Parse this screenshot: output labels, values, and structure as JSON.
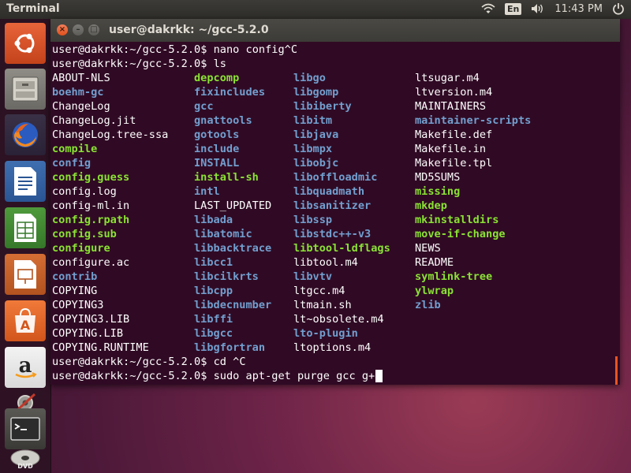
{
  "panel": {
    "app_title": "Terminal",
    "lang": "En",
    "time": "11:43 PM",
    "icons": [
      "wifi-icon",
      "keyboard-language",
      "volume-icon",
      "power-icon"
    ]
  },
  "launcher": {
    "items": [
      "ubuntu-dash",
      "files",
      "firefox",
      "libreoffice-writer",
      "libreoffice-calc",
      "libreoffice-impress",
      "ubuntu-software",
      "amazon",
      "system-settings",
      "terminal",
      "dvd"
    ]
  },
  "window": {
    "title": "user@dakrkk: ~/gcc-5.2.0"
  },
  "terminal": {
    "lines_before": [
      "user@dakrkk:~/gcc-5.2.0$ nano config^C",
      "user@dakrkk:~/gcc-5.2.0$ ls"
    ],
    "ls_columns": [
      [
        {
          "t": "ABOUT-NLS",
          "c": "file"
        },
        {
          "t": "boehm-gc",
          "c": "dir"
        },
        {
          "t": "ChangeLog",
          "c": "file"
        },
        {
          "t": "ChangeLog.jit",
          "c": "file"
        },
        {
          "t": "ChangeLog.tree-ssa",
          "c": "file"
        },
        {
          "t": "compile",
          "c": "exec"
        },
        {
          "t": "config",
          "c": "dir"
        },
        {
          "t": "config.guess",
          "c": "exec"
        },
        {
          "t": "config.log",
          "c": "file"
        },
        {
          "t": "config-ml.in",
          "c": "file"
        },
        {
          "t": "config.rpath",
          "c": "exec"
        },
        {
          "t": "config.sub",
          "c": "exec"
        },
        {
          "t": "configure",
          "c": "exec"
        },
        {
          "t": "configure.ac",
          "c": "file"
        },
        {
          "t": "contrib",
          "c": "dir"
        },
        {
          "t": "COPYING",
          "c": "file"
        },
        {
          "t": "COPYING3",
          "c": "file"
        },
        {
          "t": "COPYING3.LIB",
          "c": "file"
        },
        {
          "t": "COPYING.LIB",
          "c": "file"
        },
        {
          "t": "COPYING.RUNTIME",
          "c": "file"
        }
      ],
      [
        {
          "t": "depcomp",
          "c": "exec"
        },
        {
          "t": "fixincludes",
          "c": "dir"
        },
        {
          "t": "gcc",
          "c": "dir"
        },
        {
          "t": "gnattools",
          "c": "dir"
        },
        {
          "t": "gotools",
          "c": "dir"
        },
        {
          "t": "include",
          "c": "dir"
        },
        {
          "t": "INSTALL",
          "c": "dir"
        },
        {
          "t": "install-sh",
          "c": "exec"
        },
        {
          "t": "intl",
          "c": "dir"
        },
        {
          "t": "LAST_UPDATED",
          "c": "file"
        },
        {
          "t": "libada",
          "c": "dir"
        },
        {
          "t": "libatomic",
          "c": "dir"
        },
        {
          "t": "libbacktrace",
          "c": "dir"
        },
        {
          "t": "libcc1",
          "c": "dir"
        },
        {
          "t": "libcilkrts",
          "c": "dir"
        },
        {
          "t": "libcpp",
          "c": "dir"
        },
        {
          "t": "libdecnumber",
          "c": "dir"
        },
        {
          "t": "libffi",
          "c": "dir"
        },
        {
          "t": "libgcc",
          "c": "dir"
        },
        {
          "t": "libgfortran",
          "c": "dir"
        }
      ],
      [
        {
          "t": "libgo",
          "c": "dir"
        },
        {
          "t": "libgomp",
          "c": "dir"
        },
        {
          "t": "libiberty",
          "c": "dir"
        },
        {
          "t": "libitm",
          "c": "dir"
        },
        {
          "t": "libjava",
          "c": "dir"
        },
        {
          "t": "libmpx",
          "c": "dir"
        },
        {
          "t": "libobjc",
          "c": "dir"
        },
        {
          "t": "liboffloadmic",
          "c": "dir"
        },
        {
          "t": "libquadmath",
          "c": "dir"
        },
        {
          "t": "libsanitizer",
          "c": "dir"
        },
        {
          "t": "libssp",
          "c": "dir"
        },
        {
          "t": "libstdc++-v3",
          "c": "dir"
        },
        {
          "t": "libtool-ldflags",
          "c": "exec"
        },
        {
          "t": "libtool.m4",
          "c": "file"
        },
        {
          "t": "libvtv",
          "c": "dir"
        },
        {
          "t": "ltgcc.m4",
          "c": "file"
        },
        {
          "t": "ltmain.sh",
          "c": "file"
        },
        {
          "t": "lt~obsolete.m4",
          "c": "file"
        },
        {
          "t": "lto-plugin",
          "c": "dir"
        },
        {
          "t": "ltoptions.m4",
          "c": "file"
        }
      ],
      [
        {
          "t": "ltsugar.m4",
          "c": "file"
        },
        {
          "t": "ltversion.m4",
          "c": "file"
        },
        {
          "t": "MAINTAINERS",
          "c": "file"
        },
        {
          "t": "maintainer-scripts",
          "c": "dir"
        },
        {
          "t": "Makefile.def",
          "c": "file"
        },
        {
          "t": "Makefile.in",
          "c": "file"
        },
        {
          "t": "Makefile.tpl",
          "c": "file"
        },
        {
          "t": "MD5SUMS",
          "c": "file"
        },
        {
          "t": "missing",
          "c": "exec"
        },
        {
          "t": "mkdep",
          "c": "exec"
        },
        {
          "t": "mkinstalldirs",
          "c": "exec"
        },
        {
          "t": "move-if-change",
          "c": "exec"
        },
        {
          "t": "NEWS",
          "c": "file"
        },
        {
          "t": "README",
          "c": "file"
        },
        {
          "t": "symlink-tree",
          "c": "exec"
        },
        {
          "t": "ylwrap",
          "c": "exec"
        },
        {
          "t": "zlib",
          "c": "dir"
        }
      ]
    ],
    "lines_after": [
      "user@dakrkk:~/gcc-5.2.0$ cd ^C",
      "user@dakrkk:~/gcc-5.2.0$ sudo apt-get purge gcc g+"
    ]
  },
  "colors": {
    "terminal_bg": "#300a24",
    "exec": "#8ae234",
    "dir": "#729fcf",
    "accent": "#e95420"
  }
}
